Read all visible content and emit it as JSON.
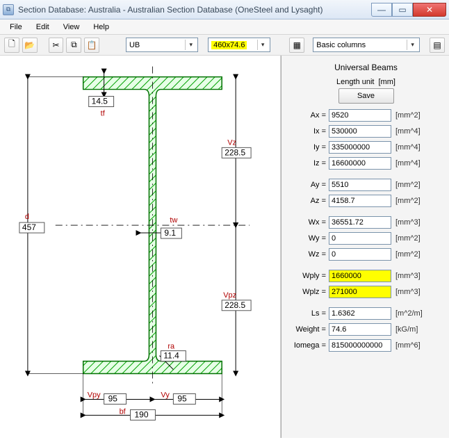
{
  "window": {
    "title": "Section Database: Australia - Australian Section Database (OneSteel and Lysaght)"
  },
  "menu": {
    "file": "File",
    "edit": "Edit",
    "view": "View",
    "help": "Help"
  },
  "toolbar": {
    "type_combo": "UB",
    "section_combo": "460x74.6",
    "cols_combo": "Basic columns"
  },
  "panel": {
    "title": "Universal Beams",
    "length_unit_label": "Length unit",
    "length_unit": "[mm]",
    "save": "Save",
    "rows": {
      "Ax": {
        "lbl": "Ax =",
        "val": "9520",
        "unit": "[mm^2]"
      },
      "Ix": {
        "lbl": "Ix =",
        "val": "530000",
        "unit": "[mm^4]"
      },
      "Iy": {
        "lbl": "Iy =",
        "val": "335000000",
        "unit": "[mm^4]"
      },
      "Iz": {
        "lbl": "Iz =",
        "val": "16600000",
        "unit": "[mm^4]"
      },
      "Ay": {
        "lbl": "Ay =",
        "val": "5510",
        "unit": "[mm^2]"
      },
      "Az": {
        "lbl": "Az =",
        "val": "4158.7",
        "unit": "[mm^2]"
      },
      "Wx": {
        "lbl": "Wx =",
        "val": "36551.72",
        "unit": "[mm^3]"
      },
      "Wy": {
        "lbl": "Wy =",
        "val": "0",
        "unit": "[mm^2]"
      },
      "Wz": {
        "lbl": "Wz =",
        "val": "0",
        "unit": "[mm^2]"
      },
      "Wply": {
        "lbl": "Wply =",
        "val": "1660000",
        "unit": "[mm^3]"
      },
      "Wplz": {
        "lbl": "Wplz =",
        "val": "271000",
        "unit": "[mm^3]"
      },
      "Ls": {
        "lbl": "Ls =",
        "val": "1.6362",
        "unit": "[m^2/m]"
      },
      "Weight": {
        "lbl": "Weight =",
        "val": "74.6",
        "unit": "[kG/m]"
      },
      "Iomega": {
        "lbl": "Iomega =",
        "val": "815000000000",
        "unit": "[mm^6]"
      }
    }
  },
  "dimensions": {
    "d": {
      "name": "d",
      "val": "457"
    },
    "tf": {
      "name": "tf",
      "val": "14.5"
    },
    "tw": {
      "name": "tw",
      "val": "9.1"
    },
    "bf": {
      "name": "bf",
      "val": "190"
    },
    "ra": {
      "name": "ra",
      "val": "11.4"
    },
    "Vz": {
      "name": "Vz",
      "val": "228.5"
    },
    "Vpz": {
      "name": "Vpz",
      "val": "228.5"
    },
    "Vy": {
      "name": "Vy",
      "val": "95"
    },
    "Vpy": {
      "name": "Vpy",
      "val": "95"
    }
  }
}
